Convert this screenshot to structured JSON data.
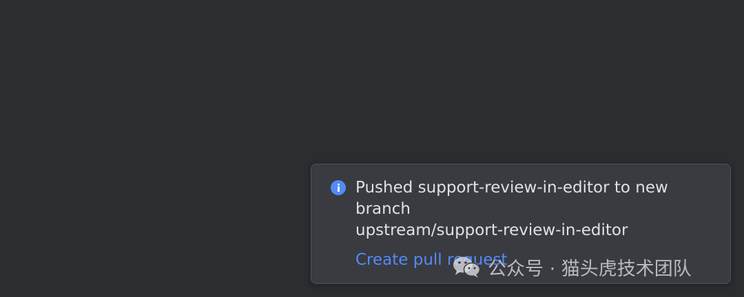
{
  "notification": {
    "icon": "info-icon",
    "accent_color": "#548af7",
    "message": "Pushed support-review-in-editor to new\nbranch\nupstream/support-review-in-editor",
    "action_label": "Create pull request"
  },
  "watermark": {
    "text": "公众号 · 猫头虎技术团队",
    "icon": "wechat-logo-icon"
  }
}
